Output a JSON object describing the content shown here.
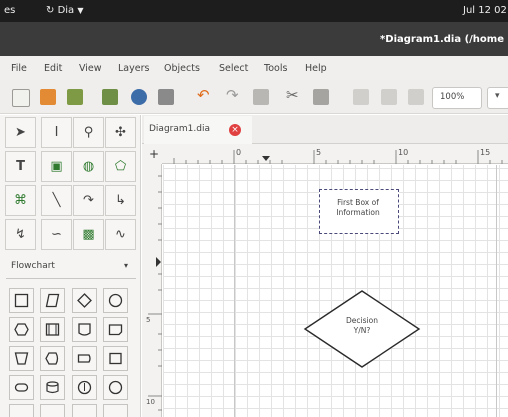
{
  "topbar": {
    "left_fragment": "es",
    "app_name": "Dia",
    "app_arrow": "▼",
    "clock": "Jul 12  02"
  },
  "window": {
    "title": "*Diagram1.dia (/home"
  },
  "menubar": {
    "items": [
      "File",
      "Edit",
      "View",
      "Layers",
      "Objects",
      "Select",
      "Tools",
      "Help"
    ]
  },
  "toolbar": {
    "icons": [
      "new-icon",
      "open-icon",
      "save-icon",
      "save-as-icon",
      "print-icon",
      "export-icon",
      "undo-icon",
      "redo-icon",
      "copy-icon",
      "cut-icon",
      "paste-icon",
      "zoom-in-icon",
      "zoom-out-icon",
      "zoom-fit-icon"
    ],
    "zoom_value": "100%",
    "zoom_dropdown": "▾"
  },
  "palette": {
    "tools": [
      {
        "icon": "pointer-icon",
        "glyph": "➤"
      },
      {
        "icon": "text-cursor-icon",
        "glyph": "I"
      },
      {
        "icon": "magnify-icon",
        "glyph": "⚲"
      },
      {
        "icon": "move-icon",
        "glyph": "✣"
      },
      {
        "icon": "text-tool-icon",
        "glyph": "T"
      },
      {
        "icon": "box-tool-icon",
        "glyph": "▣"
      },
      {
        "icon": "ellipse-tool-icon",
        "glyph": "◍"
      },
      {
        "icon": "polygon-tool-icon",
        "glyph": "⬠"
      },
      {
        "icon": "beziergon-tool-icon",
        "glyph": "⌘"
      },
      {
        "icon": "line-tool-icon",
        "glyph": "╲"
      },
      {
        "icon": "arc-tool-icon",
        "glyph": "↷"
      },
      {
        "icon": "zigzag-tool-icon",
        "glyph": "↳"
      },
      {
        "icon": "polyline-tool-icon",
        "glyph": "↯"
      },
      {
        "icon": "bezier-tool-icon",
        "glyph": "∽"
      },
      {
        "icon": "image-tool-icon",
        "glyph": "▩"
      },
      {
        "icon": "outline-tool-icon",
        "glyph": "∿"
      }
    ],
    "sheet": {
      "label": "Flowchart",
      "arrow": "▾"
    }
  },
  "tab": {
    "label": "Diagram1.dia",
    "close": "×"
  },
  "rulers": {
    "h_numbers": [
      "0",
      "5",
      "10",
      "15"
    ],
    "v_numbers": [
      "5",
      "10"
    ]
  },
  "diagram": {
    "box": {
      "line1": "First Box of",
      "line2": "Information"
    },
    "decision": {
      "line1": "Decision",
      "line2": "Y/N?"
    }
  },
  "colors": {
    "topbar": "#1d1d1d",
    "titlebar": "#3b3b3b",
    "close_tab": "#e04040",
    "selection_border": "#4a4a7a"
  }
}
